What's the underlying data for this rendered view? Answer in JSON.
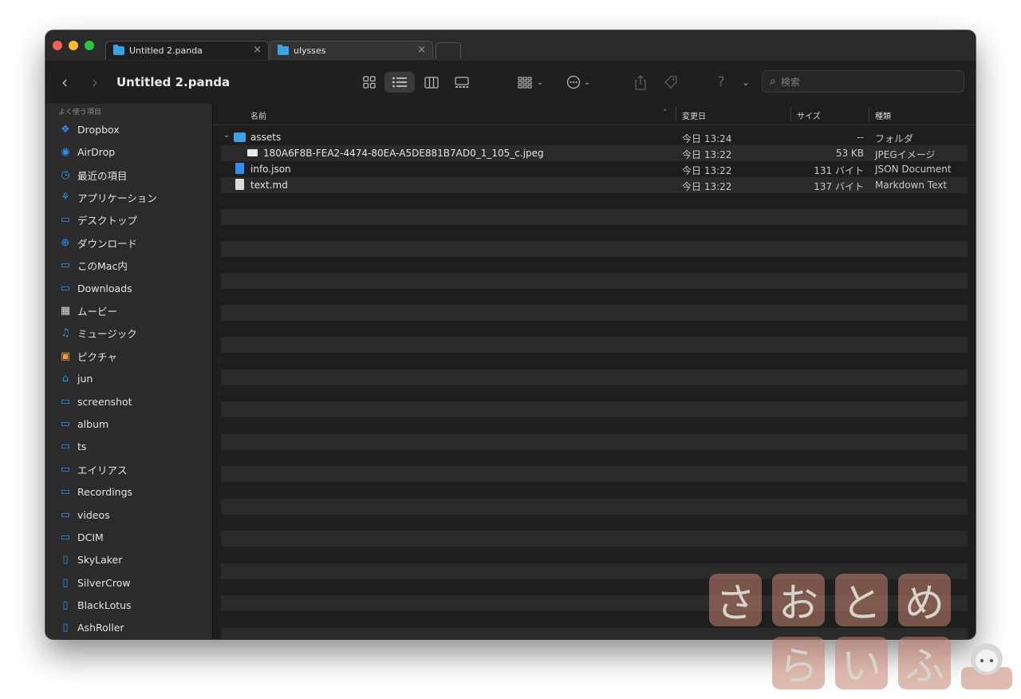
{
  "tabs": [
    {
      "label": "Untitled 2.panda",
      "active": true
    },
    {
      "label": "ulysses",
      "active": false
    }
  ],
  "toolbar": {
    "title": "Untitled 2.panda",
    "search_placeholder": "検索"
  },
  "sidebar": {
    "header": "よく使う項目",
    "items": [
      {
        "label": "Dropbox",
        "icon": "dropbox-icon"
      },
      {
        "label": "AirDrop",
        "icon": "airdrop-icon"
      },
      {
        "label": "最近の項目",
        "icon": "clock-icon"
      },
      {
        "label": "アプリケーション",
        "icon": "applications-icon"
      },
      {
        "label": "デスクトップ",
        "icon": "desktop-icon"
      },
      {
        "label": "ダウンロード",
        "icon": "download-icon"
      },
      {
        "label": "このMac内",
        "icon": "folder-icon"
      },
      {
        "label": "Downloads",
        "icon": "folder-icon"
      },
      {
        "label": "ムービー",
        "icon": "movie-icon"
      },
      {
        "label": "ミュージック",
        "icon": "music-icon"
      },
      {
        "label": "ピクチャ",
        "icon": "pictures-icon"
      },
      {
        "label": "jun",
        "icon": "home-icon"
      },
      {
        "label": "screenshot",
        "icon": "folder-icon"
      },
      {
        "label": "album",
        "icon": "folder-icon"
      },
      {
        "label": "ts",
        "icon": "folder-icon"
      },
      {
        "label": "エイリアス",
        "icon": "folder-icon"
      },
      {
        "label": "Recordings",
        "icon": "folder-icon"
      },
      {
        "label": "videos",
        "icon": "folder-icon"
      },
      {
        "label": "DCIM",
        "icon": "folder-icon"
      },
      {
        "label": "SkyLaker",
        "icon": "document-icon"
      },
      {
        "label": "SilverCrow",
        "icon": "document-icon"
      },
      {
        "label": "BlackLotus",
        "icon": "document-icon"
      },
      {
        "label": "AshRoller",
        "icon": "document-icon"
      }
    ]
  },
  "columns": {
    "name": "名前",
    "date": "変更日",
    "size": "サイズ",
    "kind": "種類"
  },
  "files": [
    {
      "name": "assets",
      "date": "今日 13:24",
      "size": "--",
      "kind": "フォルダ",
      "icon": "folder-icon",
      "expanded": true
    },
    {
      "name": "180A6F8B-FEA2-4474-80EA-A5DE881B7AD0_1_105_c.jpeg",
      "date": "今日 13:22",
      "size": "53 KB",
      "kind": "JPEGイメージ",
      "icon": "jpeg-icon"
    },
    {
      "name": "info.json",
      "date": "今日 13:22",
      "size": "131 バイト",
      "kind": "JSON Document",
      "icon": "json-icon"
    },
    {
      "name": "text.md",
      "date": "今日 13:22",
      "size": "137 バイト",
      "kind": "Markdown Text",
      "icon": "text-file-icon"
    }
  ],
  "watermark": {
    "row1": [
      "さ",
      "お",
      "と",
      "め"
    ],
    "row2": [
      "ら",
      "い",
      "ふ"
    ]
  }
}
